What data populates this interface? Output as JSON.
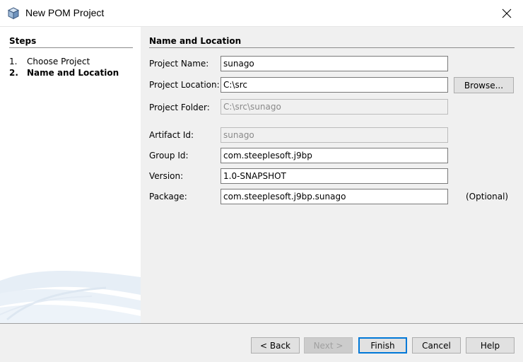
{
  "window": {
    "title": "New POM Project",
    "icon": "cube-icon",
    "close_icon": "close-icon"
  },
  "steps": {
    "heading": "Steps",
    "items": [
      {
        "number": "1.",
        "label": "Choose Project",
        "active": false
      },
      {
        "number": "2.",
        "label": "Name and Location",
        "active": true
      }
    ]
  },
  "form": {
    "heading": "Name and Location",
    "fields": {
      "project_name": {
        "label": "Project Name:",
        "value": "sunago",
        "enabled": true
      },
      "project_location": {
        "label": "Project Location:",
        "value": "C:\\src",
        "enabled": true
      },
      "project_folder": {
        "label": "Project Folder:",
        "value": "C:\\src\\sunago",
        "enabled": false
      },
      "artifact_id": {
        "label": "Artifact Id:",
        "value": "sunago",
        "enabled": false
      },
      "group_id": {
        "label": "Group Id:",
        "value": "com.steeplesoft.j9bp",
        "enabled": true
      },
      "version": {
        "label": "Version:",
        "value": "1.0-SNAPSHOT",
        "enabled": true
      },
      "package": {
        "label": "Package:",
        "value": "com.steeplesoft.j9bp.sunago",
        "enabled": true
      }
    },
    "browse_label": "Browse...",
    "optional_label": "(Optional)"
  },
  "buttons": {
    "back": "< Back",
    "next": "Next >",
    "finish": "Finish",
    "cancel": "Cancel",
    "help": "Help"
  },
  "colors": {
    "accent": "#0078d7",
    "panel_bg": "#f0f0f0",
    "steps_bg": "#ffffff"
  }
}
